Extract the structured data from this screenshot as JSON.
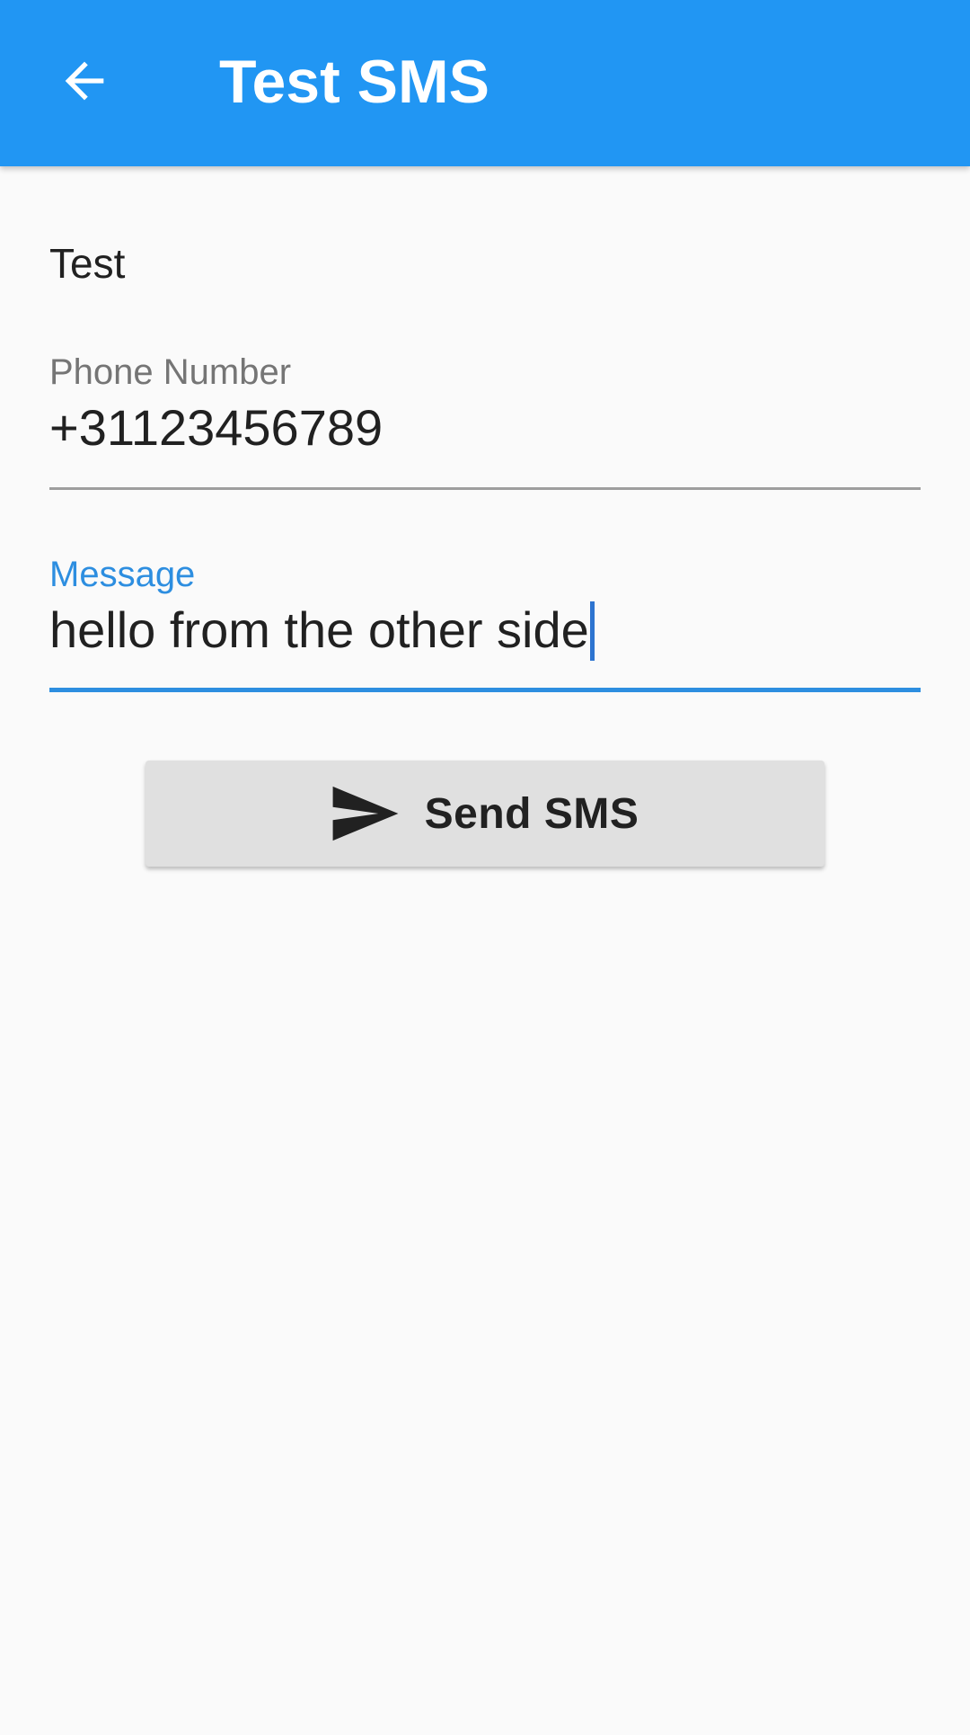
{
  "appbar": {
    "title": "Test SMS",
    "back_icon": "arrow-left-icon",
    "color": "#2196f3"
  },
  "content": {
    "intro": "Test",
    "phone": {
      "label": "Phone Number",
      "value": "+31123456789"
    },
    "message": {
      "label": "Message",
      "value": "hello from the other side",
      "accent_color": "#2d8ee0"
    },
    "send_button": {
      "label": "Send SMS",
      "icon": "send-icon"
    }
  }
}
